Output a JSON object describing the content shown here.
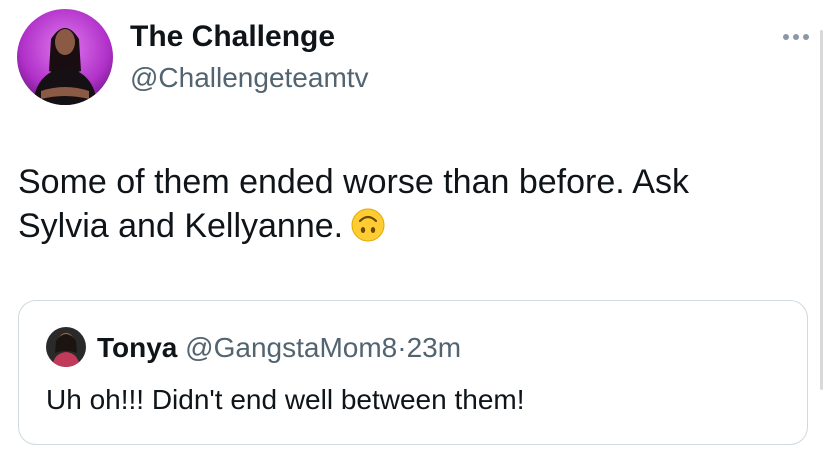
{
  "tweet": {
    "display_name": "The Challenge",
    "handle": "@Challengeteamtv",
    "text": "Some of them ended worse than before. Ask Sylvia and Kellyanne.",
    "emoji": "upside-down-face",
    "more_icon": "more-dots-icon"
  },
  "quote": {
    "name": "Tonya",
    "handle": "@GangstaMom8",
    "separator": "·",
    "time": "23m",
    "text": "Uh oh!!!  Didn't end well between them!"
  },
  "colors": {
    "text": "#0f1419",
    "secondary": "#536471",
    "border": "#cfd9de",
    "avatar_bg": "#b030c8",
    "emoji": "#ffcc33"
  }
}
